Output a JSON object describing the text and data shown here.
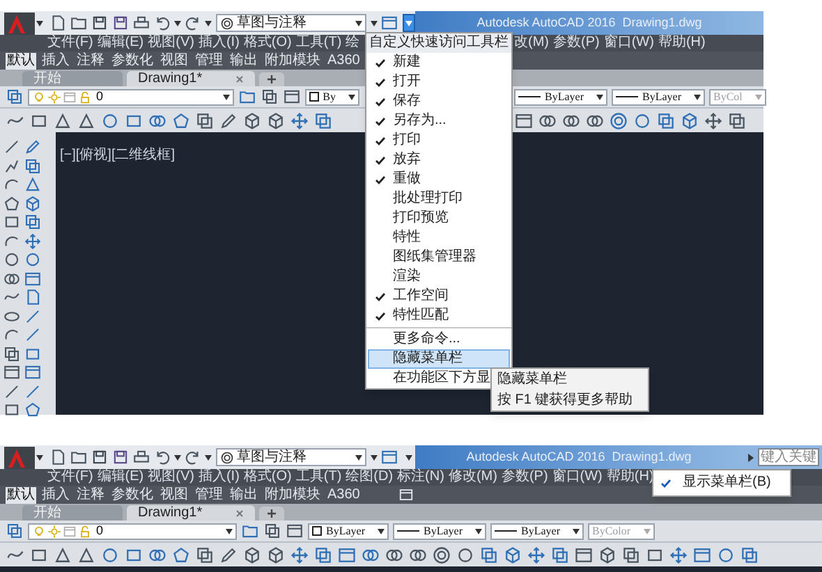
{
  "screens": [
    {
      "title_bar": {
        "workspace": "草图与注释",
        "title": "Autodesk AutoCAD 2016  Drawing1.dwg"
      },
      "menu_bar": [
        {
          "items": [
            "文件(F)",
            "编辑(E)",
            "视图(V)",
            "插入(I)",
            "格式(O)",
            "工具(T)",
            "绘"
          ]
        },
        {
          "items": [
            "改(M)",
            "参数(P)",
            "窗口(W)",
            "帮助(H)"
          ]
        }
      ],
      "ribbon_tabs": [
        {
          "label": "默认",
          "selected": true
        },
        {
          "label": "插入",
          "selected": false
        },
        {
          "label": "注释",
          "selected": false
        },
        {
          "label": "参数化",
          "selected": false
        },
        {
          "label": "视图",
          "selected": false
        },
        {
          "label": "管理",
          "selected": false
        },
        {
          "label": "输出",
          "selected": false
        },
        {
          "label": "附加模块",
          "selected": false
        },
        {
          "label": "A360",
          "selected": false
        }
      ],
      "file_tabs": [
        {
          "label": "开始",
          "selected": false
        },
        {
          "label": "Drawing1*",
          "selected": true
        }
      ],
      "layer_toolbar": {
        "layer": "0",
        "groups": [
          {
            "combos": [
              {
                "kind": "color",
                "text": "By",
                "disabled": false
              }
            ]
          },
          {
            "combos": [
              {
                "kind": "linetype",
                "text": "ByLayer",
                "disabled": false
              },
              {
                "kind": "lineweight",
                "text": "ByLayer",
                "disabled": false
              },
              {
                "kind": "plotstyle",
                "text": "ByCol",
                "disabled": true
              }
            ]
          }
        ]
      },
      "viewport_label": "[−][俯视][二维线框]",
      "quick_access_menu": {
        "title": "自定义快速访问工具栏",
        "sections": [
          {
            "items": [
              {
                "label": "新建",
                "checked": true,
                "selected": false
              },
              {
                "label": "打开",
                "checked": true,
                "selected": false
              },
              {
                "label": "保存",
                "checked": true,
                "selected": false
              },
              {
                "label": "另存为...",
                "checked": true,
                "selected": false
              },
              {
                "label": "打印",
                "checked": true,
                "selected": false
              },
              {
                "label": "放弃",
                "checked": true,
                "selected": false
              },
              {
                "label": "重做",
                "checked": true,
                "selected": false
              },
              {
                "label": "批处理打印",
                "checked": false,
                "selected": false
              },
              {
                "label": "打印预览",
                "checked": false,
                "selected": false
              },
              {
                "label": "特性",
                "checked": false,
                "selected": false
              },
              {
                "label": "图纸集管理器",
                "checked": false,
                "selected": false
              },
              {
                "label": "渲染",
                "checked": false,
                "selected": false
              },
              {
                "label": "工作空间",
                "checked": true,
                "selected": false
              },
              {
                "label": "特性匹配",
                "checked": true,
                "selected": false
              }
            ]
          },
          {
            "items": [
              {
                "label": "更多命令...",
                "checked": false,
                "selected": false
              },
              {
                "label": "隐藏菜单栏",
                "checked": false,
                "selected": true
              },
              {
                "label": "在功能区下方显",
                "checked": false,
                "selected": false
              }
            ]
          }
        ],
        "submenu": [
          "隐藏菜单栏",
          "按 F1 键获得更多帮助"
        ]
      }
    },
    {
      "title_bar": {
        "workspace": "草图与注释",
        "title": "Autodesk AutoCAD 2016  Drawing1.dwg",
        "search_placeholder": "键入关键"
      },
      "menu_bar": [
        {
          "items": [
            "文件(F)",
            "编辑(E)",
            "视图(V)",
            "插入(I)",
            "格式(O)",
            "工具(T)",
            "绘图(D)",
            "标注(N)",
            "修改(M)",
            "参数(P)",
            "窗口(W)",
            "帮助(H)"
          ]
        }
      ],
      "ribbon_tabs": [
        {
          "label": "默认",
          "selected": true
        },
        {
          "label": "插入",
          "selected": false
        },
        {
          "label": "注释",
          "selected": false
        },
        {
          "label": "参数化",
          "selected": false
        },
        {
          "label": "视图",
          "selected": false
        },
        {
          "label": "管理",
          "selected": false
        },
        {
          "label": "输出",
          "selected": false
        },
        {
          "label": "附加模块",
          "selected": false
        },
        {
          "label": "A360",
          "selected": false
        }
      ],
      "file_tabs": [
        {
          "label": "开始",
          "selected": false
        },
        {
          "label": "Drawing1*",
          "selected": true
        }
      ],
      "layer_toolbar": {
        "layer": "0",
        "groups": [
          {
            "combos": [
              {
                "kind": "color",
                "text": "ByLayer",
                "disabled": false
              },
              {
                "kind": "linetype",
                "text": "ByLayer",
                "disabled": false
              },
              {
                "kind": "lineweight",
                "text": "ByLayer",
                "disabled": false
              },
              {
                "kind": "plotstyle",
                "text": "ByColor",
                "disabled": true
              }
            ]
          }
        ]
      },
      "menu_popup": {
        "items": [
          {
            "label": "显示菜单栏(B)",
            "checked": true
          }
        ]
      }
    }
  ]
}
